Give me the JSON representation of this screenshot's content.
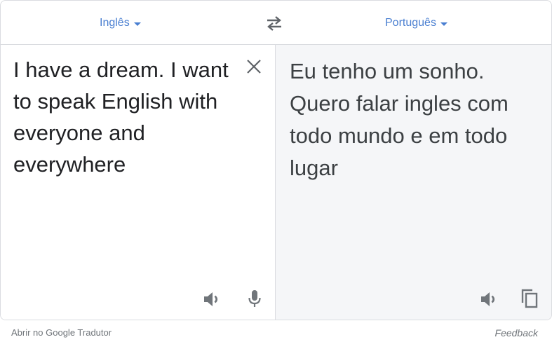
{
  "languages": {
    "source": "Inglês",
    "target": "Português"
  },
  "source_text": "I have a dream. I want to speak English with everyone and everywhere",
  "translated_text": "Eu tenho um sonho. Quero falar ingles com todo mundo e em todo lugar",
  "footer": {
    "open_link": "Abrir no Google Tradutor",
    "feedback": "Feedback"
  },
  "icons": {
    "swap": "swap-arrows-icon",
    "clear": "close-icon",
    "listen_source": "speaker-icon",
    "voice_input": "microphone-icon",
    "listen_target": "speaker-icon",
    "copy": "copy-icon"
  },
  "colors": {
    "accent": "#4a7fd1",
    "icon": "#70757a",
    "target_bg": "#f5f6f8",
    "border": "#dadce0"
  }
}
